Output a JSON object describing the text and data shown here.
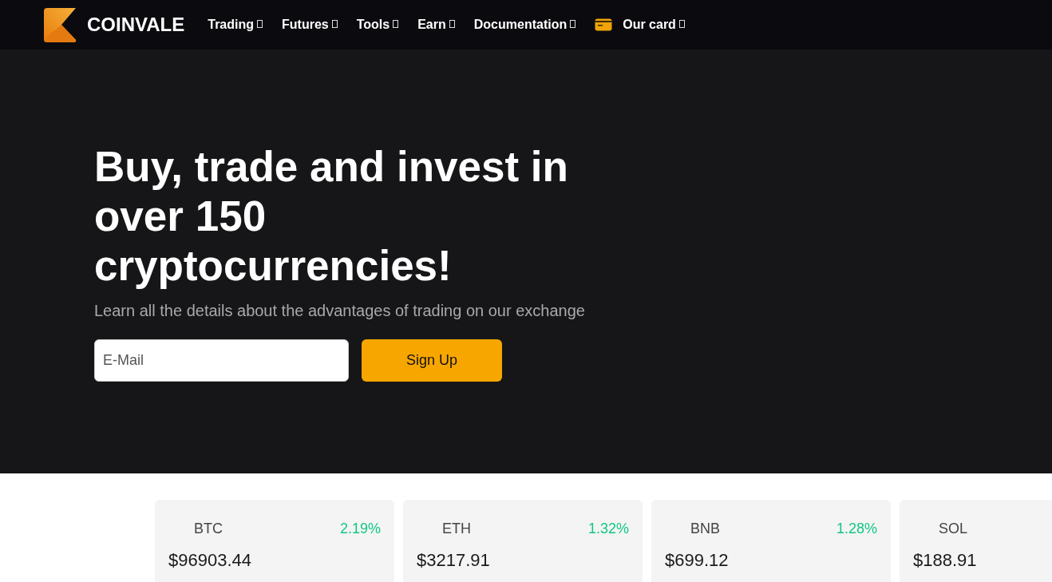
{
  "brand": {
    "name": "COINVALE"
  },
  "nav": [
    {
      "label": "Trading",
      "kind": "text"
    },
    {
      "label": "Futures",
      "kind": "text"
    },
    {
      "label": "Tools",
      "kind": "text"
    },
    {
      "label": "Earn",
      "kind": "text"
    },
    {
      "label": "Documentation",
      "kind": "text"
    },
    {
      "label": "Our card",
      "kind": "card"
    }
  ],
  "hero": {
    "headline": "Buy, trade and invest in over 150 cryptocurrencies!",
    "subtitle": "Learn all the details about the advantages of trading on our exchange",
    "email": {
      "placeholder": "E-Mail"
    },
    "button": "Sign Up"
  },
  "tickers": [
    {
      "symbol": "BTC",
      "change": "2.19%",
      "price": "$96903.44"
    },
    {
      "symbol": "ETH",
      "change": "1.32%",
      "price": "$3217.91"
    },
    {
      "symbol": "BNB",
      "change": "1.28%",
      "price": "$699.12"
    },
    {
      "symbol": "SOL",
      "price": "$188.91"
    }
  ]
}
